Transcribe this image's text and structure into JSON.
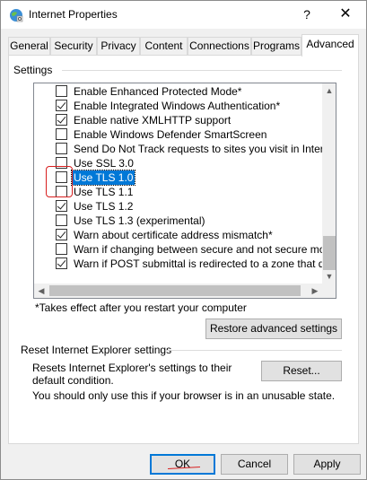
{
  "window": {
    "title": "Internet Properties",
    "help_label": "?",
    "close_label": "✕"
  },
  "tabs": [
    {
      "label": "General"
    },
    {
      "label": "Security"
    },
    {
      "label": "Privacy"
    },
    {
      "label": "Content"
    },
    {
      "label": "Connections"
    },
    {
      "label": "Programs"
    },
    {
      "label": "Advanced",
      "active": true
    }
  ],
  "settings": {
    "label": "Settings",
    "rows": [
      {
        "label": "Enable Enhanced Protected Mode*",
        "checked": false
      },
      {
        "label": "Enable Integrated Windows Authentication*",
        "checked": true
      },
      {
        "label": "Enable native XMLHTTP support",
        "checked": true
      },
      {
        "label": "Enable Windows Defender SmartScreen",
        "checked": false
      },
      {
        "label": "Send Do Not Track requests to sites you visit in Internet E",
        "checked": false
      },
      {
        "label": "Use SSL 3.0",
        "checked": false
      },
      {
        "label": "Use TLS 1.0",
        "checked": false,
        "selected": true
      },
      {
        "label": "Use TLS 1.1",
        "checked": false
      },
      {
        "label": "Use TLS 1.2",
        "checked": true
      },
      {
        "label": "Use TLS 1.3 (experimental)",
        "checked": false
      },
      {
        "label": "Warn about certificate address mismatch*",
        "checked": true
      },
      {
        "label": "Warn if changing between secure and not secure mode",
        "checked": false
      },
      {
        "label": "Warn if POST submittal is redirected to a zone that does n",
        "checked": true
      }
    ],
    "note": "*Takes effect after you restart your computer",
    "restore_button": "Restore advanced settings"
  },
  "reset": {
    "label": "Reset Internet Explorer settings",
    "description": "Resets Internet Explorer's settings to their default condition.",
    "button": "Reset...",
    "warning": "You should only use this if your browser is in an unusable state."
  },
  "footer": {
    "ok": "OK",
    "cancel": "Cancel",
    "apply": "Apply"
  },
  "colors": {
    "selection": "#0078d7",
    "annotation": "#d81e1e"
  },
  "icons": {
    "title": "internet-options-globe-icon"
  }
}
